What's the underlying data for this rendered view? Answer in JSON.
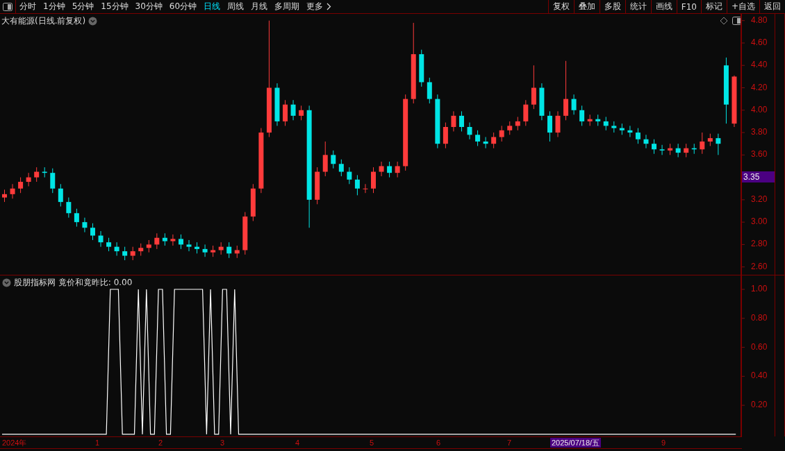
{
  "toolbar": {
    "periods": [
      {
        "label": "分时",
        "selected": false
      },
      {
        "label": "1分钟",
        "selected": false
      },
      {
        "label": "5分钟",
        "selected": false
      },
      {
        "label": "15分钟",
        "selected": false
      },
      {
        "label": "30分钟",
        "selected": false
      },
      {
        "label": "60分钟",
        "selected": false
      },
      {
        "label": "日线",
        "selected": true
      },
      {
        "label": "周线",
        "selected": false
      },
      {
        "label": "月线",
        "selected": false
      },
      {
        "label": "多周期",
        "selected": false
      }
    ],
    "more": "更多",
    "actions": [
      "复权",
      "叠加",
      "多股",
      "统计",
      "画线",
      "F10",
      "标记",
      "+自选",
      "返回"
    ]
  },
  "price_panel": {
    "title": "大有能源(日线.前复权)",
    "current_price": "3.35",
    "chart_data": {
      "type": "candlestick",
      "ylim": [
        2.53,
        4.86
      ],
      "categories": [
        null,
        null,
        null,
        null,
        null,
        null,
        null,
        null,
        null,
        null,
        null,
        null,
        null,
        null,
        null,
        null,
        null,
        null,
        null,
        null,
        null,
        null,
        null,
        null,
        null,
        null,
        null,
        null,
        null,
        null,
        null,
        null,
        null,
        null,
        null,
        null,
        null,
        null,
        null,
        null,
        null,
        null,
        null,
        null,
        null,
        null,
        null,
        null,
        null,
        null,
        null,
        null,
        null,
        null,
        null,
        null,
        null,
        null,
        null,
        null,
        null,
        null,
        null,
        null,
        null,
        null,
        null,
        null,
        null,
        null,
        null,
        null,
        null,
        null,
        null,
        null,
        null,
        null,
        null,
        null,
        null,
        null,
        null,
        null,
        null,
        null,
        null,
        null,
        null,
        null,
        null,
        null
      ],
      "yticks": [
        {
          "value": 4.8,
          "label": "4.80"
        },
        {
          "value": 4.6,
          "label": "4.60"
        },
        {
          "value": 4.4,
          "label": "4.40"
        },
        {
          "value": 4.2,
          "label": "4.20"
        },
        {
          "value": 4.0,
          "label": "4.00"
        },
        {
          "value": 3.8,
          "label": "3.80"
        },
        {
          "value": 3.6,
          "label": "3.60"
        },
        {
          "value": 3.2,
          "label": "3.20"
        },
        {
          "value": 3.0,
          "label": "3.00"
        },
        {
          "value": 2.8,
          "label": "2.80"
        },
        {
          "value": 2.6,
          "label": "2.60"
        }
      ],
      "ohlc": [
        [
          3.22,
          3.29,
          3.18,
          3.25
        ],
        [
          3.25,
          3.34,
          3.21,
          3.3
        ],
        [
          3.3,
          3.4,
          3.26,
          3.36
        ],
        [
          3.36,
          3.44,
          3.32,
          3.4
        ],
        [
          3.4,
          3.49,
          3.36,
          3.45
        ],
        [
          3.45,
          3.49,
          3.4,
          3.44
        ],
        [
          3.44,
          3.48,
          3.26,
          3.3
        ],
        [
          3.3,
          3.34,
          3.14,
          3.18
        ],
        [
          3.18,
          3.22,
          3.04,
          3.08
        ],
        [
          3.08,
          3.12,
          2.96,
          3.0
        ],
        [
          3.0,
          3.04,
          2.91,
          2.95
        ],
        [
          2.95,
          2.99,
          2.84,
          2.88
        ],
        [
          2.88,
          2.92,
          2.78,
          2.82
        ],
        [
          2.82,
          2.86,
          2.74,
          2.78
        ],
        [
          2.78,
          2.82,
          2.7,
          2.74
        ],
        [
          2.74,
          2.78,
          2.66,
          2.7
        ],
        [
          2.7,
          2.78,
          2.66,
          2.74
        ],
        [
          2.74,
          2.81,
          2.7,
          2.77
        ],
        [
          2.77,
          2.84,
          2.73,
          2.8
        ],
        [
          2.8,
          2.9,
          2.76,
          2.86
        ],
        [
          2.86,
          2.9,
          2.79,
          2.83
        ],
        [
          2.83,
          2.89,
          2.79,
          2.85
        ],
        [
          2.85,
          2.89,
          2.76,
          2.8
        ],
        [
          2.8,
          2.84,
          2.74,
          2.78
        ],
        [
          2.78,
          2.82,
          2.72,
          2.76
        ],
        [
          2.76,
          2.8,
          2.69,
          2.73
        ],
        [
          2.73,
          2.79,
          2.69,
          2.75
        ],
        [
          2.75,
          2.82,
          2.71,
          2.78
        ],
        [
          2.78,
          2.82,
          2.68,
          2.72
        ],
        [
          2.72,
          2.79,
          2.68,
          2.75
        ],
        [
          2.75,
          3.09,
          2.71,
          3.05
        ],
        [
          3.05,
          3.34,
          3.01,
          3.3
        ],
        [
          3.3,
          3.84,
          3.26,
          3.8
        ],
        [
          3.8,
          4.8,
          3.76,
          4.2
        ],
        [
          4.2,
          4.24,
          3.86,
          3.9
        ],
        [
          3.9,
          4.09,
          3.86,
          4.05
        ],
        [
          4.05,
          4.09,
          3.91,
          3.95
        ],
        [
          3.95,
          4.04,
          3.91,
          4.0
        ],
        [
          4.0,
          4.04,
          2.95,
          3.2
        ],
        [
          3.2,
          3.49,
          3.16,
          3.45
        ],
        [
          3.45,
          3.72,
          3.41,
          3.6
        ],
        [
          3.6,
          3.64,
          3.48,
          3.52
        ],
        [
          3.52,
          3.56,
          3.41,
          3.45
        ],
        [
          3.45,
          3.49,
          3.34,
          3.38
        ],
        [
          3.38,
          3.42,
          3.24,
          3.3
        ],
        [
          3.3,
          3.34,
          3.26,
          3.3
        ],
        [
          3.3,
          3.49,
          3.26,
          3.45
        ],
        [
          3.45,
          3.54,
          3.41,
          3.5
        ],
        [
          3.5,
          3.54,
          3.4,
          3.44
        ],
        [
          3.44,
          3.54,
          3.4,
          3.5
        ],
        [
          3.5,
          4.14,
          3.46,
          4.1
        ],
        [
          4.1,
          4.78,
          4.06,
          4.5
        ],
        [
          4.5,
          4.54,
          4.21,
          4.25
        ],
        [
          4.25,
          4.29,
          4.06,
          4.1
        ],
        [
          4.1,
          4.14,
          3.66,
          3.7
        ],
        [
          3.7,
          3.89,
          3.66,
          3.85
        ],
        [
          3.85,
          3.99,
          3.81,
          3.95
        ],
        [
          3.95,
          3.99,
          3.81,
          3.85
        ],
        [
          3.85,
          3.89,
          3.74,
          3.78
        ],
        [
          3.78,
          3.82,
          3.68,
          3.72
        ],
        [
          3.72,
          3.76,
          3.66,
          3.7
        ],
        [
          3.7,
          3.8,
          3.66,
          3.76
        ],
        [
          3.76,
          3.86,
          3.72,
          3.82
        ],
        [
          3.82,
          3.9,
          3.78,
          3.86
        ],
        [
          3.86,
          3.94,
          3.82,
          3.9
        ],
        [
          3.9,
          4.09,
          3.86,
          4.05
        ],
        [
          4.05,
          4.4,
          4.01,
          4.2
        ],
        [
          4.2,
          4.24,
          3.91,
          3.95
        ],
        [
          3.95,
          3.99,
          3.72,
          3.8
        ],
        [
          3.8,
          3.99,
          3.76,
          3.95
        ],
        [
          3.95,
          4.44,
          3.91,
          4.1
        ],
        [
          4.1,
          4.14,
          3.96,
          4.0
        ],
        [
          4.0,
          4.04,
          3.86,
          3.9
        ],
        [
          3.9,
          3.96,
          3.86,
          3.92
        ],
        [
          3.92,
          3.96,
          3.86,
          3.9
        ],
        [
          3.9,
          3.94,
          3.82,
          3.86
        ],
        [
          3.86,
          3.9,
          3.8,
          3.84
        ],
        [
          3.84,
          3.88,
          3.78,
          3.82
        ],
        [
          3.82,
          3.86,
          3.76,
          3.8
        ],
        [
          3.8,
          3.84,
          3.7,
          3.74
        ],
        [
          3.74,
          3.78,
          3.66,
          3.7
        ],
        [
          3.7,
          3.74,
          3.61,
          3.65
        ],
        [
          3.65,
          3.69,
          3.6,
          3.64
        ],
        [
          3.64,
          3.7,
          3.6,
          3.66
        ],
        [
          3.66,
          3.7,
          3.58,
          3.62
        ],
        [
          3.62,
          3.7,
          3.58,
          3.66
        ],
        [
          3.66,
          3.7,
          3.61,
          3.65
        ],
        [
          3.65,
          3.8,
          3.61,
          3.72
        ],
        [
          3.72,
          3.79,
          3.68,
          3.75
        ],
        [
          3.75,
          3.79,
          3.6,
          3.7
        ],
        [
          4.4,
          4.47,
          3.88,
          4.05
        ],
        [
          3.88,
          4.31,
          3.85,
          4.3
        ]
      ]
    }
  },
  "indicator_panel": {
    "title": "股朋指标网 竟价和竟昨比: 0.00",
    "chart_data": {
      "type": "line",
      "ylim": [
        -0.015,
        1.096
      ],
      "yticks": [
        {
          "value": 1,
          "label": "1.00"
        },
        {
          "value": 0.8,
          "label": "0.80"
        },
        {
          "value": 0.6,
          "label": "0.60"
        },
        {
          "value": 0.4,
          "label": "0.40"
        },
        {
          "value": 0.2,
          "label": "0.20"
        }
      ],
      "series": [
        {
          "color": "#ffffff",
          "values": [
            0,
            0,
            0,
            0,
            0,
            0,
            0,
            0,
            0,
            0,
            0,
            0,
            0,
            0,
            0,
            0,
            0,
            0,
            0,
            0,
            0,
            0,
            0,
            0,
            0,
            0,
            0,
            1,
            1,
            1,
            0,
            0,
            0,
            0,
            1,
            0,
            1,
            0,
            0,
            1,
            1,
            0,
            0,
            1,
            1,
            1,
            1,
            1,
            1,
            1,
            1,
            0,
            1,
            0,
            0,
            1,
            1,
            0,
            1,
            0,
            0,
            0,
            0,
            0,
            0,
            0,
            0,
            0,
            0,
            0,
            0,
            0,
            0,
            0,
            0,
            0,
            0,
            0,
            0,
            0,
            0,
            0,
            0,
            0,
            0,
            0,
            0,
            0,
            0,
            0,
            0,
            0,
            0,
            0,
            0,
            0,
            0,
            0,
            0,
            0,
            0,
            0,
            0,
            0,
            0,
            0,
            0,
            0,
            0,
            0,
            0,
            0,
            0,
            0,
            0,
            0,
            0,
            0,
            0,
            0,
            0,
            0,
            0,
            0,
            0,
            0,
            0,
            0,
            0,
            0,
            0,
            0,
            0,
            0,
            0,
            0,
            0,
            0,
            0,
            0,
            0,
            0,
            0,
            0,
            0,
            0,
            0,
            0,
            0,
            0,
            0,
            0,
            0,
            0,
            0,
            0,
            0,
            0,
            0,
            0,
            0,
            0,
            0,
            0,
            0,
            0,
            0,
            0,
            0,
            0,
            0,
            0,
            0,
            0,
            0,
            0,
            0,
            0,
            0,
            0,
            0,
            0,
            0,
            0
          ]
        }
      ]
    }
  },
  "date_axis": [
    {
      "label": "2024年",
      "highlighted": false
    },
    {
      "label": "1",
      "highlighted": false
    },
    {
      "label": "2",
      "highlighted": false
    },
    {
      "label": "3",
      "highlighted": false
    },
    {
      "label": "4",
      "highlighted": false
    },
    {
      "label": "5",
      "highlighted": false
    },
    {
      "label": "6",
      "highlighted": false
    },
    {
      "label": "7",
      "highlighted": false
    },
    {
      "label": "2025/07/18/五",
      "highlighted": true
    },
    {
      "label": "9",
      "highlighted": false
    }
  ]
}
